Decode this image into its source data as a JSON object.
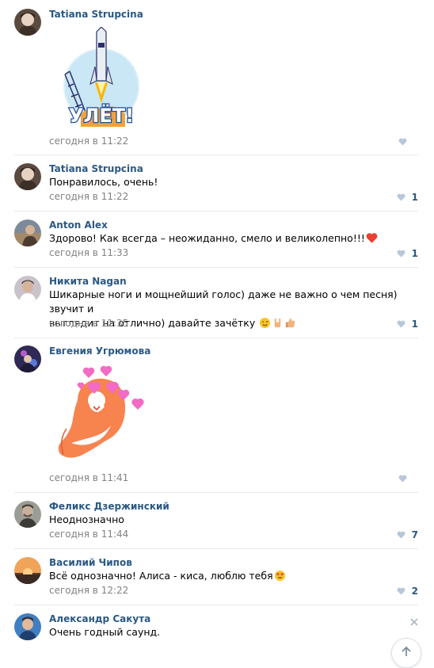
{
  "colors": {
    "author": "#2a5885",
    "meta": "#828282",
    "like_icon": "#b8c7d9",
    "separator": "#e7e8ec"
  },
  "comments": [
    {
      "author": "Tatiana Strupcina",
      "text": "",
      "time": "сегодня в 11:22",
      "likes": "",
      "sticker": "УЛЁТ!"
    },
    {
      "author": "Tatiana Strupcina",
      "text": "Понравилось, очень!",
      "time": "сегодня в 11:22",
      "likes": "1"
    },
    {
      "author": "Anton Alex",
      "text": "Здорово! Как всегда – неожиданно, смело и великолепно!!!",
      "time": "сегодня в 11:33",
      "likes": "1"
    },
    {
      "author": "Никита Nagan",
      "text_line1": "Шикарные ноги и мощнейший голос) даже не важно о чем песня) звучит и",
      "text_line2": "выглядит на отлично) давайте зачётку",
      "time": "сегодня в 11:35",
      "likes": "1"
    },
    {
      "author": "Евгения Угрюмова",
      "text": "",
      "time": "сегодня в 11:41",
      "likes": "",
      "sticker": "cat-hearts"
    },
    {
      "author": "Феликс Дзержинский",
      "text": "Неоднозначно",
      "time": "сегодня в 11:44",
      "likes": "7"
    },
    {
      "author": "Василий Чипов",
      "text": "Всё однозначно! Алиса - киса, люблю тебя",
      "time": "сегодня в 12:22",
      "likes": "2"
    },
    {
      "author": "Александр Сакута",
      "text": "Очень годный саунд.",
      "time": "",
      "likes": ""
    }
  ],
  "icons": {
    "like": "heart-icon",
    "close": "close-icon",
    "scroll_up": "arrow-up-icon"
  }
}
